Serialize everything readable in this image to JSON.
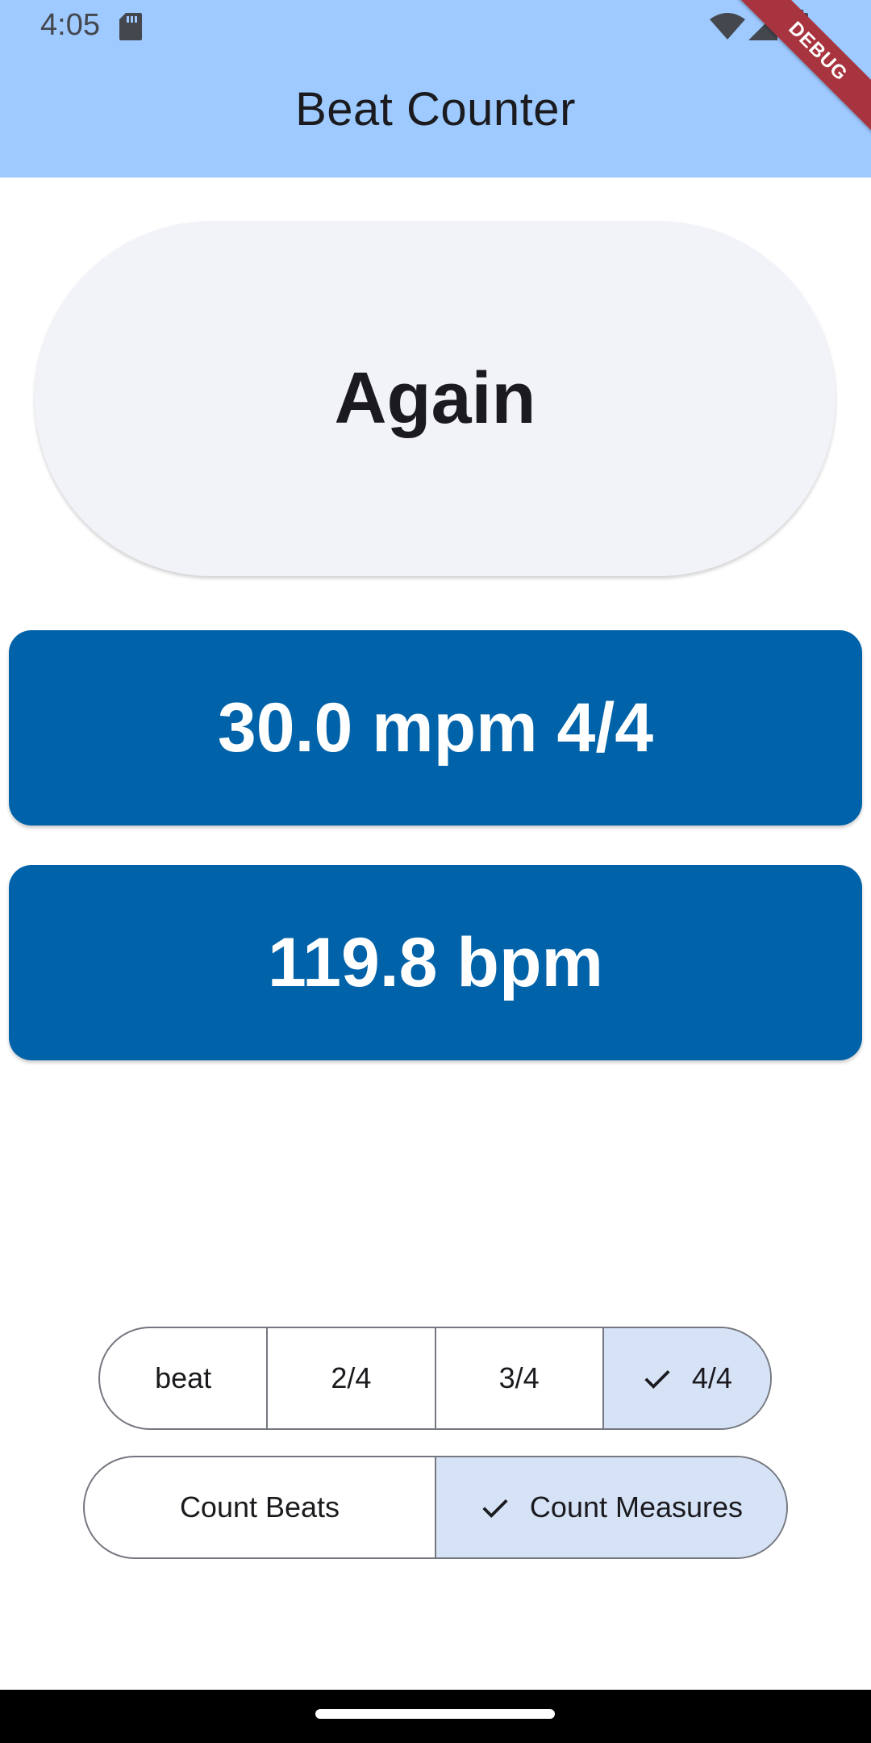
{
  "status_bar": {
    "time": "4:05",
    "icons": [
      "sd-card-icon",
      "wifi-icon",
      "cell-signal-icon",
      "battery-icon"
    ]
  },
  "app_bar": {
    "title": "Beat Counter",
    "background": "#9ecaff",
    "debug_banner": "DEBUG"
  },
  "main": {
    "again_button_label": "Again",
    "tempo_measures": "30.0 mpm 4/4",
    "tempo_beats": "119.8 bpm",
    "card_color": "#0062a8"
  },
  "meter_selector": {
    "options": [
      {
        "label": "beat",
        "selected": false
      },
      {
        "label": "2/4",
        "selected": false
      },
      {
        "label": "3/4",
        "selected": false
      },
      {
        "label": "4/4",
        "selected": true
      }
    ]
  },
  "count_mode_selector": {
    "options": [
      {
        "label": "Count Beats",
        "selected": false
      },
      {
        "label": "Count Measures",
        "selected": true
      }
    ]
  },
  "colors": {
    "selected_segment": "#d6e3f7",
    "outline": "#74777f"
  }
}
